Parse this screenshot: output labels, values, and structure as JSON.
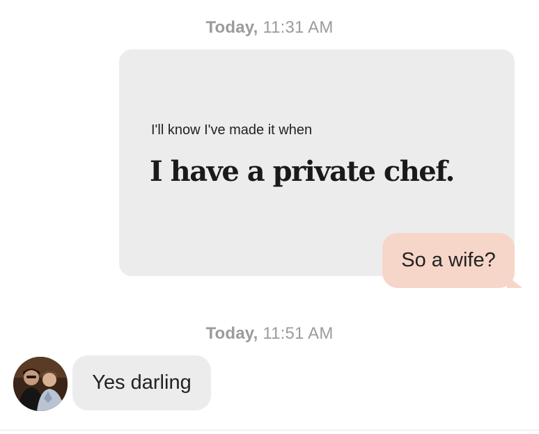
{
  "thread": {
    "messages_1_timestamp": {
      "day": "Today,",
      "time": "11:31 AM"
    },
    "prompt_card": {
      "label": "I'll know I've made it when",
      "answer": "I have a private chef."
    },
    "outgoing_reply": "So a wife?",
    "messages_2_timestamp": {
      "day": "Today,",
      "time": "11:51 AM"
    },
    "incoming_reply": "Yes darling"
  },
  "colors": {
    "outgoing_bubble": "#f6d6c8",
    "incoming_bubble": "#ececec",
    "timestamp_text": "#9b9b9b"
  },
  "icons": {
    "avatar": "profile-photo-avatar"
  }
}
